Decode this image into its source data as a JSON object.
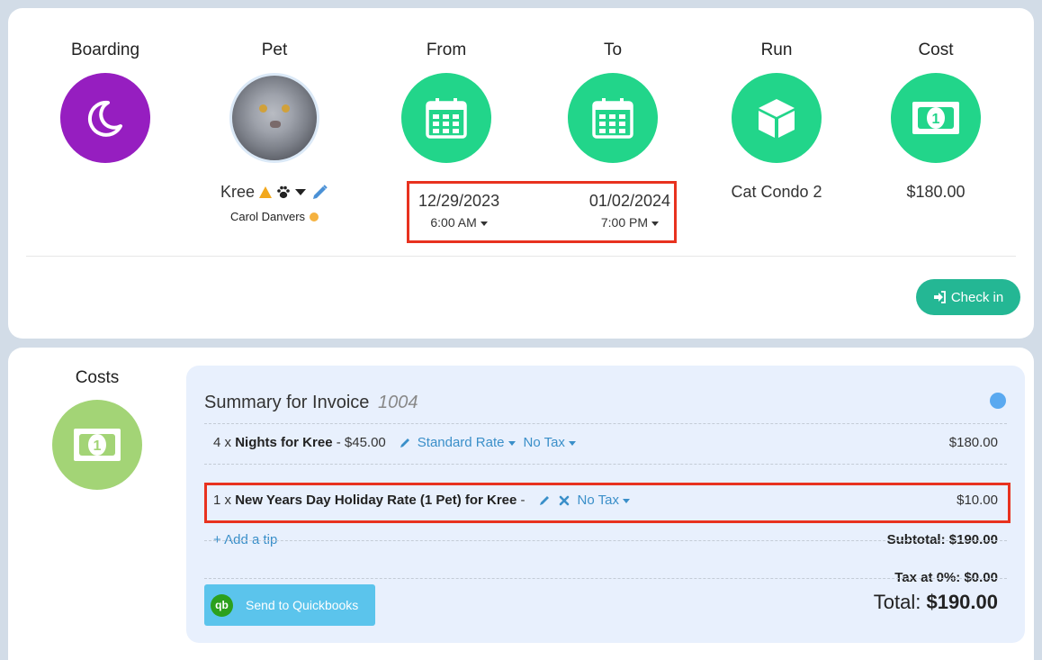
{
  "booking": {
    "columns": {
      "boarding": "Boarding",
      "pet": "Pet",
      "from": "From",
      "to": "To",
      "run": "Run",
      "cost": "Cost"
    },
    "pet": {
      "name": "Kree",
      "owner": "Carol Danvers"
    },
    "from": {
      "date": "12/29/2023",
      "time": "6:00 AM"
    },
    "to": {
      "date": "01/02/2024",
      "time": "7:00 PM"
    },
    "run": "Cat Condo 2",
    "cost": "$180.00",
    "checkin_label": "Check in"
  },
  "costs": {
    "title": "Costs",
    "summary_label": "Summary for Invoice",
    "invoice_number": "1004",
    "lines": [
      {
        "qty": "4 x",
        "name": "Nights for Kree",
        "suffix": "- $45.00",
        "rate": "Standard Rate",
        "tax": "No Tax",
        "amount": "$180.00"
      },
      {
        "qty": "1 x",
        "name": "New Years Day Holiday Rate (1 Pet) for Kree",
        "suffix": "-",
        "tax": "No Tax",
        "amount": "$10.00"
      }
    ],
    "add_tip": "+ Add a tip",
    "subtotal": "Subtotal: $190.00",
    "tax": "Tax at 0%: $0.00",
    "total_label": "Total:",
    "total_value": "$190.00",
    "quickbooks_label": "Send to Quickbooks",
    "quickbooks_logo": "qb"
  },
  "colors": {
    "boarding": "#961ec0",
    "green": "#22d58a",
    "checkin": "#24b794",
    "highlight": "#e8321f",
    "link": "#3a8fc9"
  }
}
